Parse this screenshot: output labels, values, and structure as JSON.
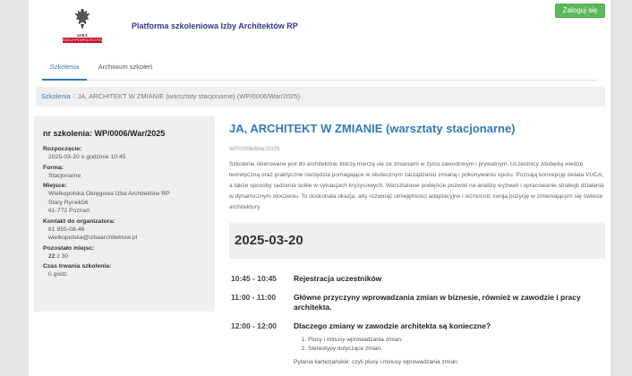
{
  "header": {
    "site_title": "Platforma szkoleniowa Izby Architektów RP",
    "login_label": "Zaloguj się",
    "logo_text_line1": "IZBA ARCHITEKTÓW",
    "logo_text_line2": "RZECZYPOSPOLITEJ POLSKIEJ"
  },
  "tabs": [
    {
      "label": "Szkolenia",
      "active": true
    },
    {
      "label": "Archiwum szkoleń",
      "active": false
    }
  ],
  "breadcrumb": {
    "root": "Szkolenia",
    "separator": "/",
    "current": "JA, ARCHITEKT W ZMIANIE (warsztaty stacjonarne) (WP/0006/War/2025)"
  },
  "sidebar": {
    "heading": "nr szkolenia: WP/0006/War/2025",
    "start_label": "Rozpoczęcie:",
    "start_value": "2025-03-20 o godzinie 10:45",
    "form_label": "Forma:",
    "form_value": "Stacjonarne",
    "place_label": "Miejsce:",
    "place_lines": [
      "Wielkopolska Okręgowa Izba Architektów RP",
      "Stary Rynek56",
      "61-772 Poznań"
    ],
    "contact_label": "Kontakt do organizatora:",
    "contact_phone": "61 855-08-46",
    "contact_email": "wielkopolska@izbaarchitektow.pl",
    "seats_label": "Pozostało miejsc:",
    "seats_bold": "22",
    "seats_rest": "z 30",
    "duration_label": "Czas trwania szkolenia:",
    "duration_value": "0 godz."
  },
  "main": {
    "title": "JA, ARCHITEKT W ZMIANIE (warsztaty stacjonarne)",
    "code": "WP/0006/War/2025",
    "description": "Szkolenie skierowane jest do architektów, którzy mierzą się ze zmianami w życiu zawodowym i prywatnym. Uczestnicy zdobędą wiedzę teoretyczną oraz praktyczne narzędzia pomagające w skutecznym zarządzaniu zmianą i pokonywaniu oporu. Poznają koncepcję świata VUCA, a także sposoby radzenia sobie w sytuacjach kryzysowych. Warsztatowe podejście pozwoli na analizę wyzwań i opracowanie strategii działania w dynamicznym otoczeniu. To doskonała okazja, aby rozwinąć umiejętności adaptacyjne i wzmocnić swoją pozycję w zmieniającym się świecie architektury."
  },
  "schedule": {
    "date": "2025-03-20",
    "items": [
      {
        "time": "10:45 - 10:45",
        "title": "Rejestracja uczestników"
      },
      {
        "time": "11:00 - 11:00",
        "title": "Główne przyczyny wprowadzania zmian w biznesie, również w zawodzie i pracy architekta."
      },
      {
        "time": "12:00 - 12:00",
        "title": "Dlaczego zmiany w zawodzie architekta są konieczne?",
        "points": [
          "Plusy i minusy wprowadzania zmian,",
          "Stereotypy dotyczące zmian."
        ],
        "extra": "Pytania kartezjańskie: czyli plusy i minusy wprowadzania zmian."
      }
    ]
  },
  "colors": {
    "accent": "#337ab7",
    "title_blue": "#2f3a8c",
    "login_green": "#5cb85c",
    "logo_red": "#c8102e"
  }
}
